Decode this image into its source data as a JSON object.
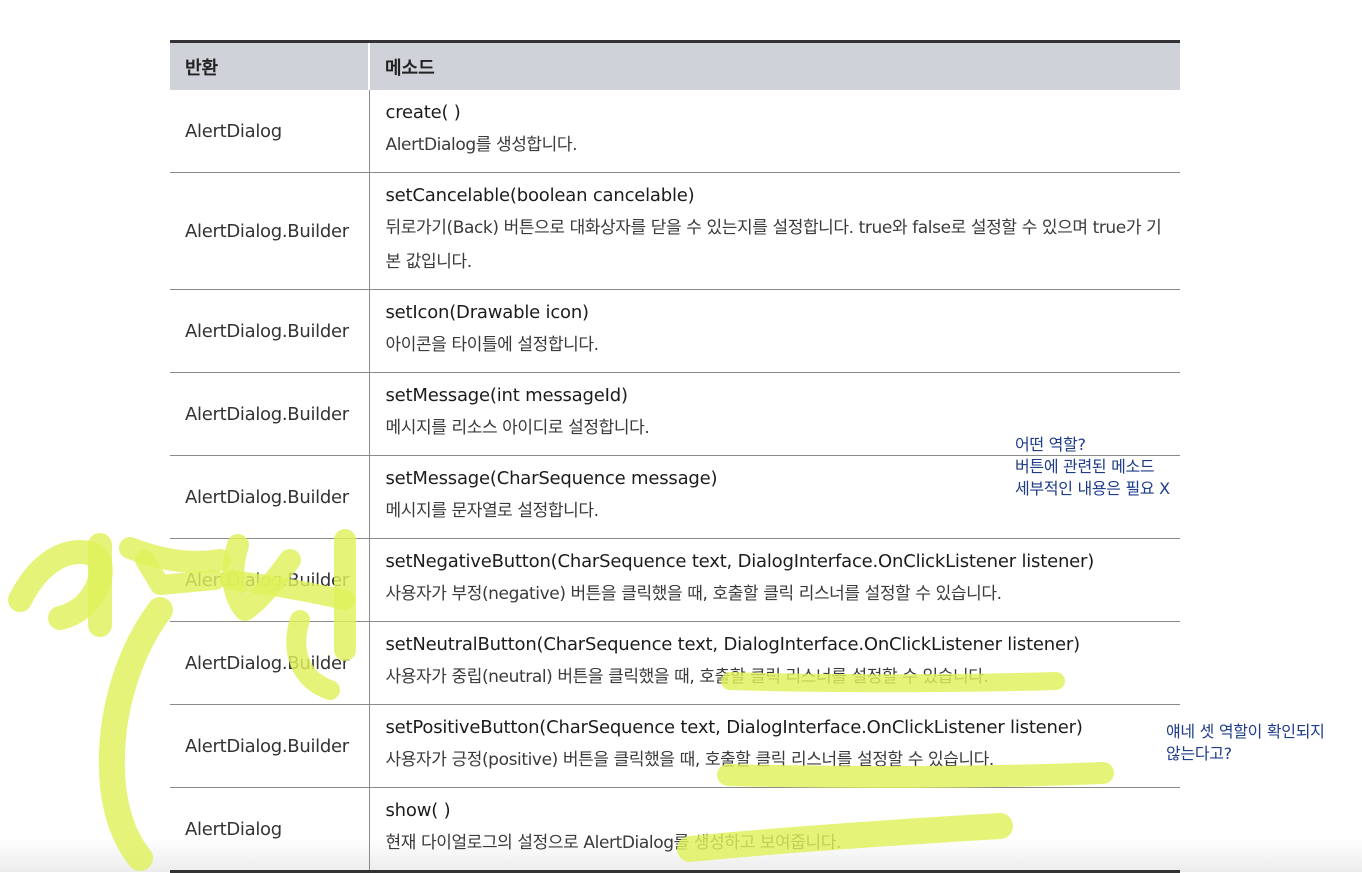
{
  "table": {
    "header": {
      "return_col": "반환",
      "method_col": "메소드"
    },
    "rows": [
      {
        "return_type": "AlertDialog",
        "signature": "create( )",
        "description": "AlertDialog를 생성합니다."
      },
      {
        "return_type": "AlertDialog.Builder",
        "signature": "setCancelable(boolean cancelable)",
        "description": "뒤로가기(Back) 버튼으로 대화상자를 닫을 수 있는지를 설정합니다. true와 false로 설정할 수 있으며 true가 기본 값입니다."
      },
      {
        "return_type": "AlertDialog.Builder",
        "signature": "setIcon(Drawable icon)",
        "description": "아이콘을 타이틀에 설정합니다."
      },
      {
        "return_type": "AlertDialog.Builder",
        "signature": "setMessage(int messageId)",
        "description": "메시지를 리소스 아이디로 설정합니다."
      },
      {
        "return_type": "AlertDialog.Builder",
        "signature": "setMessage(CharSequence message)",
        "description": "메시지를 문자열로 설정합니다."
      },
      {
        "return_type": "AlertDialog.Builder",
        "signature": "setNegativeButton(CharSequence text, DialogInterface.OnClickListener listener)",
        "description": "사용자가 부정(negative) 버튼을 클릭했을 때, 호출할 클릭 리스너를 설정할 수 있습니다."
      },
      {
        "return_type": "AlertDialog.Builder",
        "signature": "setNeutralButton(CharSequence text, DialogInterface.OnClickListener listener)",
        "description": "사용자가 중립(neutral) 버튼을 클릭했을 때, 호출할 클릭 리스너를 설정할 수 있습니다."
      },
      {
        "return_type": "AlertDialog.Builder",
        "signature": "setPositiveButton(CharSequence text, DialogInterface.OnClickListener listener)",
        "description": "사용자가 긍정(positive) 버튼을 클릭했을 때, 호출할 클릭 리스너를 설정할 수 있습니다."
      },
      {
        "return_type": "AlertDialog",
        "signature": "show( )",
        "description": "현재 다이얼로그의 설정으로 AlertDialog를 생성하고 보여줍니다."
      }
    ]
  },
  "annotations": {
    "note_right": "어떤 역할?\n버튼에 관련된 메소드\n세부적인 내용은 필요 X",
    "note_side": "얘네 셋 역할이 확인되지\n않는다고?",
    "highlight_color": "#dff25a",
    "note_color": "#1f3c8a"
  }
}
